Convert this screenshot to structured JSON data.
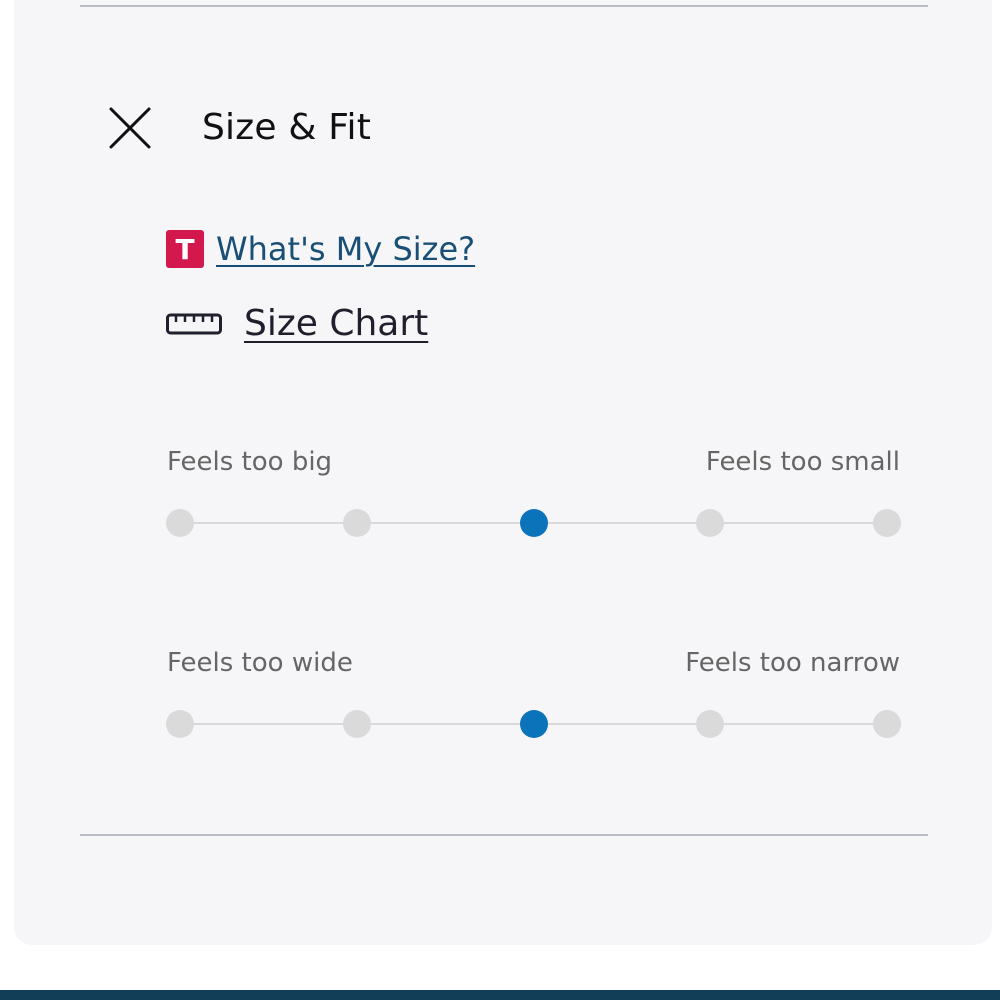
{
  "header": {
    "title": "Size & Fit",
    "close_icon": "close-icon"
  },
  "links": {
    "whats_my_size": {
      "label": "What's My Size?",
      "badge": "T",
      "badge_color": "#d3184e",
      "color": "#1a4f75"
    },
    "size_chart": {
      "label": "Size Chart",
      "icon": "ruler-icon"
    }
  },
  "fit_scales": [
    {
      "left_label": "Feels too big",
      "right_label": "Feels too small",
      "steps": 5,
      "selected_index": 2
    },
    {
      "left_label": "Feels too wide",
      "right_label": "Feels too narrow",
      "steps": 5,
      "selected_index": 2
    }
  ],
  "colors": {
    "selected_dot": "#0b73b9",
    "unselected_dot": "#dadadb",
    "footer_bar": "#123e57"
  }
}
